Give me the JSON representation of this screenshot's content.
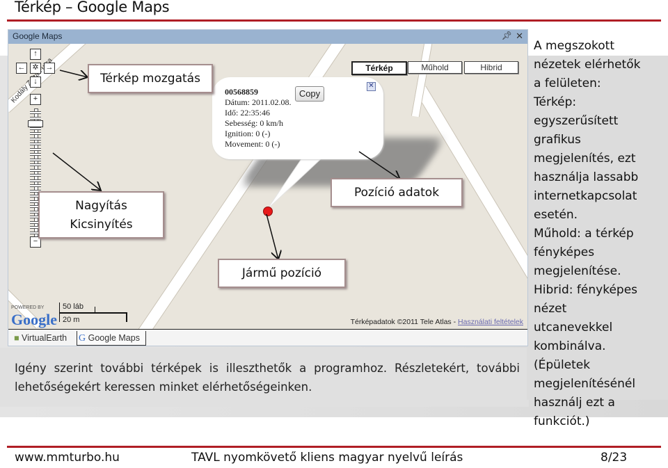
{
  "slide": {
    "title": "Térkép – Google Maps",
    "footer": {
      "website": "www.mmturbo.hu",
      "document_title": "TAVL nyomkövető kliens magyar nyelvű leírás",
      "page": "8/23"
    },
    "caption": "Igény szerint további térképek is illeszthetők a programhoz. Részletekért, további lehetőségekért keressen minket elérhetőségeinken.",
    "side_text": [
      "A megszokott",
      "nézetek elérhetők",
      "a felületen:",
      "Térkép:",
      "egyszerűsített",
      "grafikus",
      "megjelenítés, ezt",
      "használja lassabb",
      "internetkapcsolat",
      "esetén.",
      "Műhold: a térkép",
      "fényképes",
      "megjelenítése.",
      "Hibrid: fényképes",
      "nézet",
      "utcanevekkel",
      "kombinálva.",
      "(Épületek",
      "megjelenítésénél",
      "használj ezt a",
      "funkciót.)"
    ]
  },
  "window": {
    "title": "Google Maps",
    "pin_icon": "pin-icon",
    "close_icon": "close-icon",
    "map_types": [
      {
        "label": "Térkép",
        "active": true
      },
      {
        "label": "Műhold",
        "active": false
      },
      {
        "label": "Hibrid",
        "active": false
      }
    ],
    "nav_controls": {
      "up": "↑",
      "left": "←",
      "center": "✲",
      "right": "→",
      "down": "↓",
      "zoom_in": "+",
      "zoom_out": "−"
    },
    "street_labels": [
      "Kodály Zoltán utca",
      "utca",
      "L"
    ],
    "info_window": {
      "device_id": "00568859",
      "copy_label": "Copy",
      "close": "✕",
      "lines": [
        "Dátum: 2011.02.08.",
        "Idő: 22:35:46",
        "Sebesség: 0 km/h",
        "Ignition: 0 (-)",
        "Movement: 0 (-)"
      ]
    },
    "scale": {
      "imperial": "50 láb",
      "metric": "20 m"
    },
    "powered_by": "POWERED BY",
    "google_logo": "Google",
    "attribution_text": "Térképadatok ©2011 Tele Atlas - ",
    "attribution_link": "Használati feltételek",
    "tabs": [
      {
        "label": "VirtualEarth",
        "active": false
      },
      {
        "label": "Google Maps",
        "active": true
      }
    ]
  },
  "callouts": {
    "pan": "Térkép mozgatás",
    "zoom_line1": "Nagyítás",
    "zoom_line2": "Kicsinyítés",
    "position_data": "Pozíció adatok",
    "vehicle_position": "Jármű pozíció"
  },
  "colors": {
    "accent_rule": "#b01e25",
    "titlebar": "#9ab3d0",
    "map_bg": "#e9e5dc",
    "marker": "#e8191a"
  }
}
